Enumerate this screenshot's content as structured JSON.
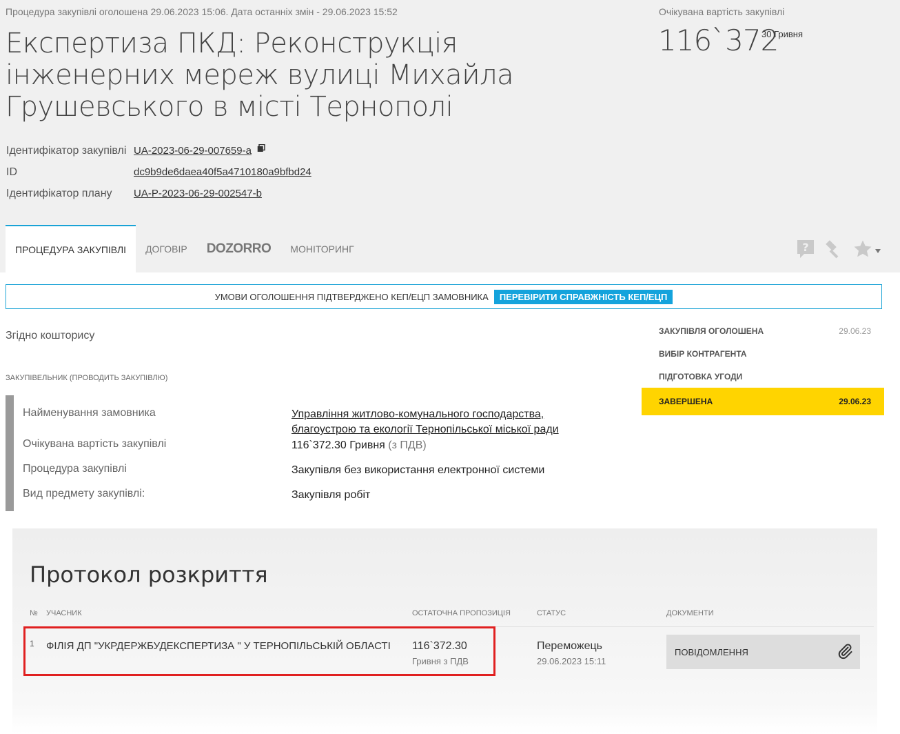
{
  "header": {
    "announce_text": "Процедура закупівлі оголошена 29.06.2023 15:06. Дата останніх змін - 29.06.2023 15:52",
    "title": "Експертиза ПКД: Реконструкція інженерних мереж вулиці Михайла Грушевського в місті Тернополі",
    "value_label": "Очікувана вартість закупівлі",
    "value_main": "116`372",
    "value_cents": "30 Гривня"
  },
  "identifiers": [
    {
      "label": "Ідентифікатор закупівлі",
      "value": "UA-2023-06-29-007659-a"
    },
    {
      "label": "ID",
      "value": "dc9b9de6daea40f5a4710180a9bfbd24"
    },
    {
      "label": "Ідентифікатор плану",
      "value": "UA-P-2023-06-29-002547-b"
    }
  ],
  "tabs": [
    {
      "label": "ПРОЦЕДУРА ЗАКУПІВЛІ"
    },
    {
      "label": "ДОГОВІР"
    },
    {
      "label": "DOZORRO"
    },
    {
      "label": "МОНІТОРИНГ"
    }
  ],
  "tool_icons": [
    "question-icon",
    "gavel-icon",
    "star-icon",
    "caret-down-icon"
  ],
  "kep": {
    "text": "УМОВИ ОГОЛОШЕННЯ ПІДТВЕРДЖЕНО КЕП/ЕЦП ЗАМОВНИКА",
    "button": "ПЕРЕВІРИТИ СПРАВЖНІСТЬ КЕП/ЕЦП"
  },
  "description": "Згідно кошторису",
  "buyer_section_label": "ЗАКУПІВЕЛЬНИК (ПРОВОДИТЬ ЗАКУПІВЛЮ)",
  "info": {
    "customer_label": "Найменування замовника",
    "customer_value": "Управління житлово-комунального господарства, благоустрою та екології Тернопільської міської ради",
    "value_label": "Очікувана вартість закупівлі",
    "value_amount": "116`372.30 Гривня",
    "value_vat": "(з ПДВ)",
    "procedure_label": "Процедура закупівлі",
    "procedure_value": "Закупівля без використання електронної системи",
    "subject_label": "Вид предмету закупівлі:",
    "subject_value": "Закупівля робіт"
  },
  "timeline": [
    {
      "label": "ЗАКУПІВЛЯ ОГОЛОШЕНА",
      "date": "29.06.23"
    },
    {
      "label": "ВИБІР КОНТРАГЕНТА",
      "date": ""
    },
    {
      "label": "ПІДГОТОВКА УГОДИ",
      "date": ""
    },
    {
      "label": "ЗАВЕРШЕНА",
      "date": "29.06.23"
    }
  ],
  "protocol": {
    "title": "Протокол розкриття",
    "columns": {
      "num": "№",
      "participant": "УЧАСНИК",
      "offer": "ОСТАТОЧНА ПРОПОЗИЦІЯ",
      "status": "СТАТУС",
      "docs": "ДОКУМЕНТИ"
    },
    "rows": [
      {
        "num": "1",
        "participant": "ФІЛІЯ ДП \"УКРДЕРЖБУДЕКСПЕРТИЗА \" У ТЕРНОПІЛЬСЬКІЙ ОБЛАСТІ",
        "offer_amount": "116`372.30",
        "offer_currency": "Гривня з ПДВ",
        "status": "Переможець",
        "status_date": "29.06.2023 15:11",
        "doc_label": "ПОВІДОМЛЕННЯ"
      }
    ]
  },
  "colors": {
    "accent": "#1aa3d6",
    "kep_button": "#14a3dc",
    "timeline_active": "#ffd400",
    "highlight": "#e02020"
  }
}
